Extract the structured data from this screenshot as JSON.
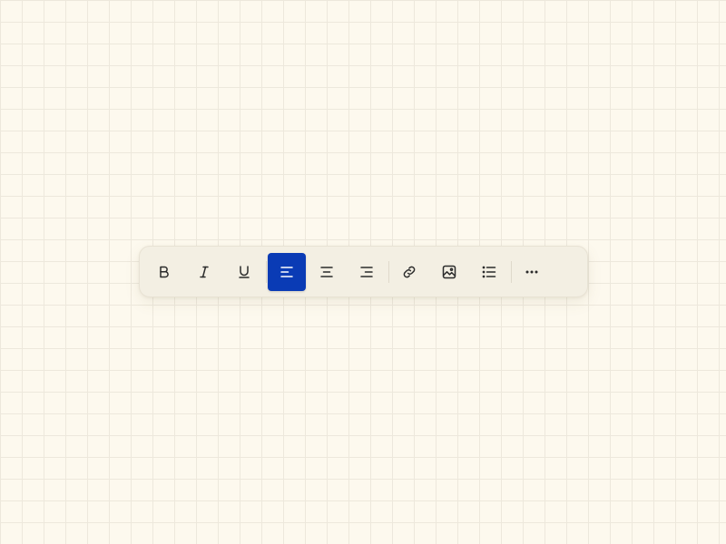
{
  "toolbar": {
    "accent_color": "#0a3bb5",
    "groups": [
      {
        "name": "text-style",
        "buttons": [
          {
            "id": "bold",
            "icon": "bold-icon",
            "active": false
          },
          {
            "id": "italic",
            "icon": "italic-icon",
            "active": false
          },
          {
            "id": "underline",
            "icon": "underline-icon",
            "active": false
          }
        ]
      },
      {
        "name": "alignment",
        "buttons": [
          {
            "id": "align-left",
            "icon": "align-left-icon",
            "active": true
          },
          {
            "id": "align-center",
            "icon": "align-center-icon",
            "active": false
          },
          {
            "id": "align-right",
            "icon": "align-right-icon",
            "active": false
          }
        ]
      },
      {
        "name": "insert",
        "buttons": [
          {
            "id": "link",
            "icon": "link-icon",
            "active": false
          },
          {
            "id": "image",
            "icon": "image-icon",
            "active": false
          },
          {
            "id": "bullet-list",
            "icon": "bullet-list-icon",
            "active": false
          }
        ]
      },
      {
        "name": "overflow",
        "buttons": [
          {
            "id": "more",
            "icon": "more-horizontal-icon",
            "active": false
          }
        ]
      }
    ]
  }
}
